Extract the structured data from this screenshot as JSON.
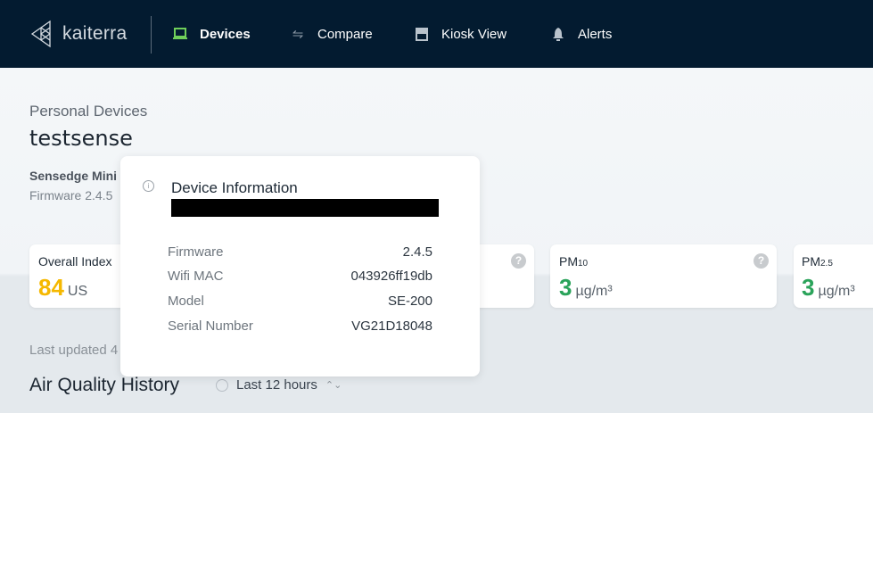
{
  "nav": {
    "brand": "kaiterra",
    "items": [
      {
        "label": "Devices",
        "icon": "laptop-icon",
        "active": true
      },
      {
        "label": "Compare",
        "icon": "compare-arrows-icon"
      },
      {
        "label": "Kiosk View",
        "icon": "storefront-icon"
      },
      {
        "label": "Alerts",
        "icon": "bell-icon"
      }
    ]
  },
  "header": {
    "breadcrumb": "Personal Devices",
    "title": "testsense",
    "model": "Sensedge Mini",
    "firmware": "Firmware 2.4.5"
  },
  "cards": [
    {
      "label": "Overall Index",
      "value": "84",
      "unit": "US",
      "color": "#f5b800"
    },
    {
      "label": "",
      "value": "",
      "unit": ""
    },
    {
      "label": "PM",
      "sub": "10",
      "value": "3",
      "unit": "µg/m³",
      "color": "#2aa35a"
    },
    {
      "label": "PM",
      "sub": "2.5",
      "value": "3",
      "unit": "µg/m³",
      "color": "#2aa35a"
    }
  ],
  "last_updated": "Last updated 4",
  "history": {
    "title": "Air Quality History",
    "range": "Last 12 hours"
  },
  "popup": {
    "title": "Device Information",
    "rows": [
      {
        "k": "Firmware",
        "v": "2.4.5"
      },
      {
        "k": "Wifi MAC",
        "v": "043926ff19db"
      },
      {
        "k": "Model",
        "v": "SE-200"
      },
      {
        "k": "Serial Number",
        "v": "VG21D18048"
      }
    ]
  }
}
